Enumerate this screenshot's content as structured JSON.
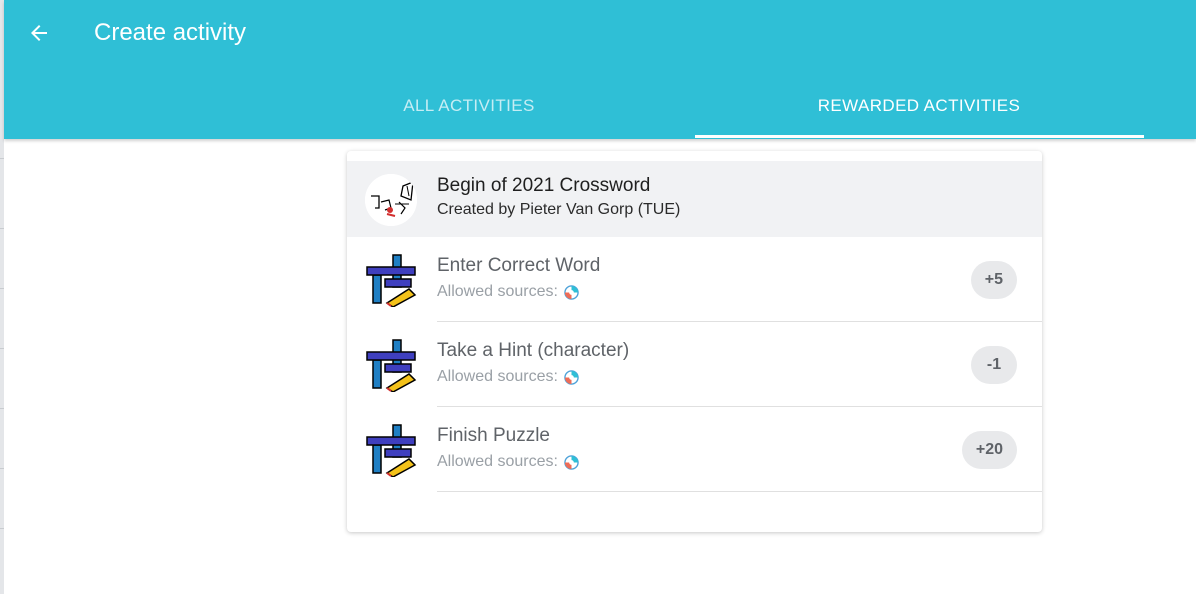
{
  "theme": {
    "accent": "#2fbfd6"
  },
  "appbar": {
    "title": "Create activity",
    "back_icon": "arrow-left-icon"
  },
  "tabs": [
    {
      "label": "ALL ACTIVITIES",
      "active": false
    },
    {
      "label": "REWARDED ACTIVITIES",
      "active": true
    }
  ],
  "activity": {
    "title": "Begin of 2021 Crossword",
    "creator": "Created by Pieter Van Gorp (TUE)",
    "avatar_icon": "cartoon-logo-icon"
  },
  "items": [
    {
      "name": "Enter Correct Word",
      "sources_label": "Allowed sources:",
      "source_icon": "source-app-icon",
      "points": "+5",
      "icon": "crossword-pencil-icon"
    },
    {
      "name": "Take a Hint (character)",
      "sources_label": "Allowed sources:",
      "source_icon": "source-app-icon",
      "points": "-1",
      "icon": "crossword-pencil-icon"
    },
    {
      "name": "Finish Puzzle",
      "sources_label": "Allowed sources:",
      "source_icon": "source-app-icon",
      "points": "+20",
      "icon": "crossword-pencil-icon"
    }
  ]
}
